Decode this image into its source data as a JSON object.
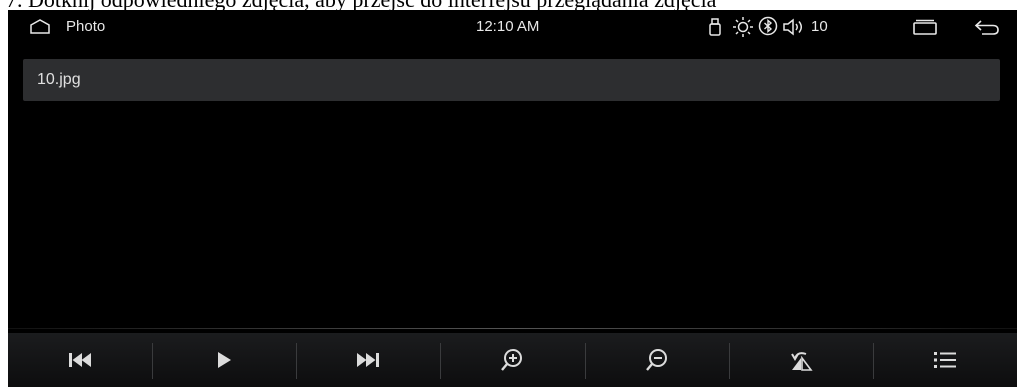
{
  "caption": "7. Dotknij odpowiedniego zdjęcia, aby przejść do interfejsu przeglądania zdjęcia",
  "status_bar": {
    "app_name": "Photo",
    "time": "12:10 AM",
    "volume_level": "10",
    "icons": [
      "home-icon",
      "usb-icon",
      "brightness-icon",
      "bluetooth-icon",
      "volume-icon",
      "recent-apps-icon",
      "back-icon"
    ]
  },
  "file_bar": {
    "file_name": "10.jpg"
  },
  "toolbar": {
    "buttons": [
      "previous-icon",
      "play-icon",
      "next-icon",
      "zoom-in-icon",
      "zoom-out-icon",
      "rotate-icon",
      "list-icon"
    ]
  },
  "colors": {
    "background": "#000000",
    "file_bar": "#2d2e30",
    "icon": "#e8e8e8"
  }
}
